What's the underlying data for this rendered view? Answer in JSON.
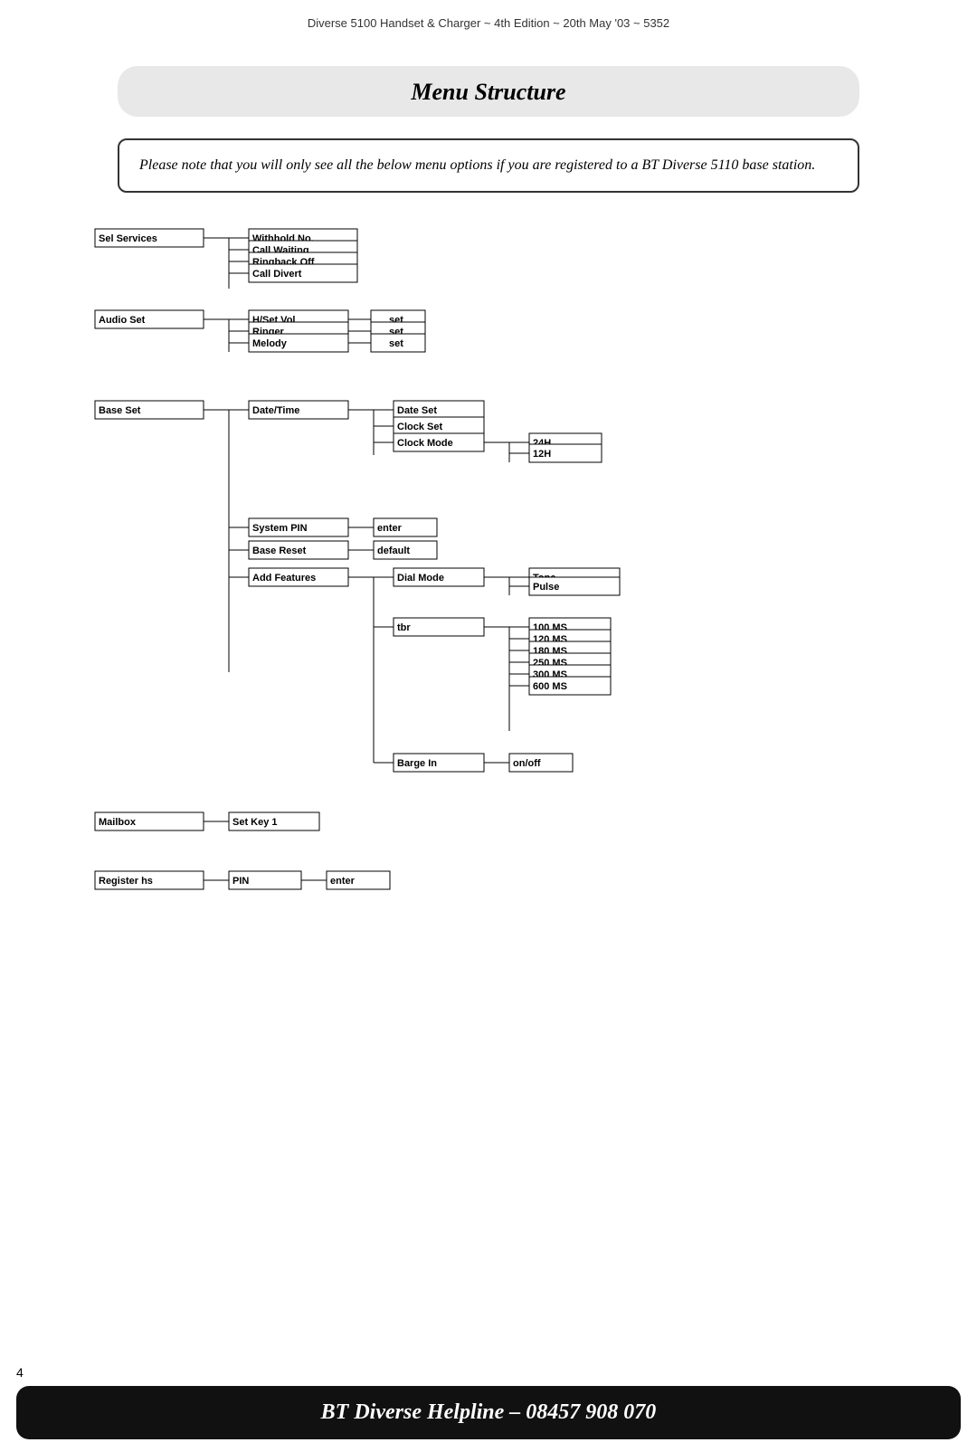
{
  "header": {
    "text": "Diverse 5100 Handset & Charger ~ 4th Edition ~ 20th May '03 ~ 5352"
  },
  "title": "Menu Structure",
  "note": "Please note that you will only see all the below menu options if you are registered to a BT Diverse 5110 base station.",
  "footer": {
    "text": "BT Diverse Helpline – 08457 908 070"
  },
  "page_number": "4",
  "menu": {
    "sections": [
      {
        "id": "sel-services",
        "label": "Sel Services",
        "children": [
          {
            "label": "Withhold No."
          },
          {
            "label": "Call Waiting"
          },
          {
            "label": "Ringback Off"
          },
          {
            "label": "Call Divert"
          }
        ]
      },
      {
        "id": "audio-set",
        "label": "Audio Set",
        "children": [
          {
            "label": "H/Set Vol",
            "leaf": "set"
          },
          {
            "label": "Ringer",
            "leaf": "set"
          },
          {
            "label": "Melody",
            "leaf": "set"
          }
        ]
      },
      {
        "id": "base-set",
        "label": "Base Set",
        "children": [
          {
            "label": "Date/Time",
            "children": [
              {
                "label": "Date Set"
              },
              {
                "label": "Clock Set"
              },
              {
                "label": "Clock Mode",
                "children": [
                  {
                    "label": "24H"
                  },
                  {
                    "label": "12H"
                  }
                ]
              }
            ]
          },
          {
            "label": "System PIN",
            "leaf": "enter"
          },
          {
            "label": "Base Reset",
            "leaf": "default"
          },
          {
            "label": "Add Features",
            "children": [
              {
                "label": "Dial Mode",
                "children": [
                  {
                    "label": "Tone"
                  },
                  {
                    "label": "Pulse"
                  }
                ]
              },
              {
                "label": "tbr",
                "children": [
                  {
                    "label": "100 MS"
                  },
                  {
                    "label": "120 MS"
                  },
                  {
                    "label": "180 MS"
                  },
                  {
                    "label": "250 MS"
                  },
                  {
                    "label": "300 MS"
                  },
                  {
                    "label": "600 MS"
                  }
                ]
              },
              {
                "label": "Barge In",
                "leaf": "on/off"
              }
            ]
          }
        ]
      },
      {
        "id": "mailbox",
        "label": "Mailbox",
        "children": [
          {
            "label": "Set Key 1"
          }
        ]
      },
      {
        "id": "register-hs",
        "label": "Register hs",
        "children": [
          {
            "label": "PIN",
            "leaf": "enter"
          }
        ]
      }
    ]
  }
}
